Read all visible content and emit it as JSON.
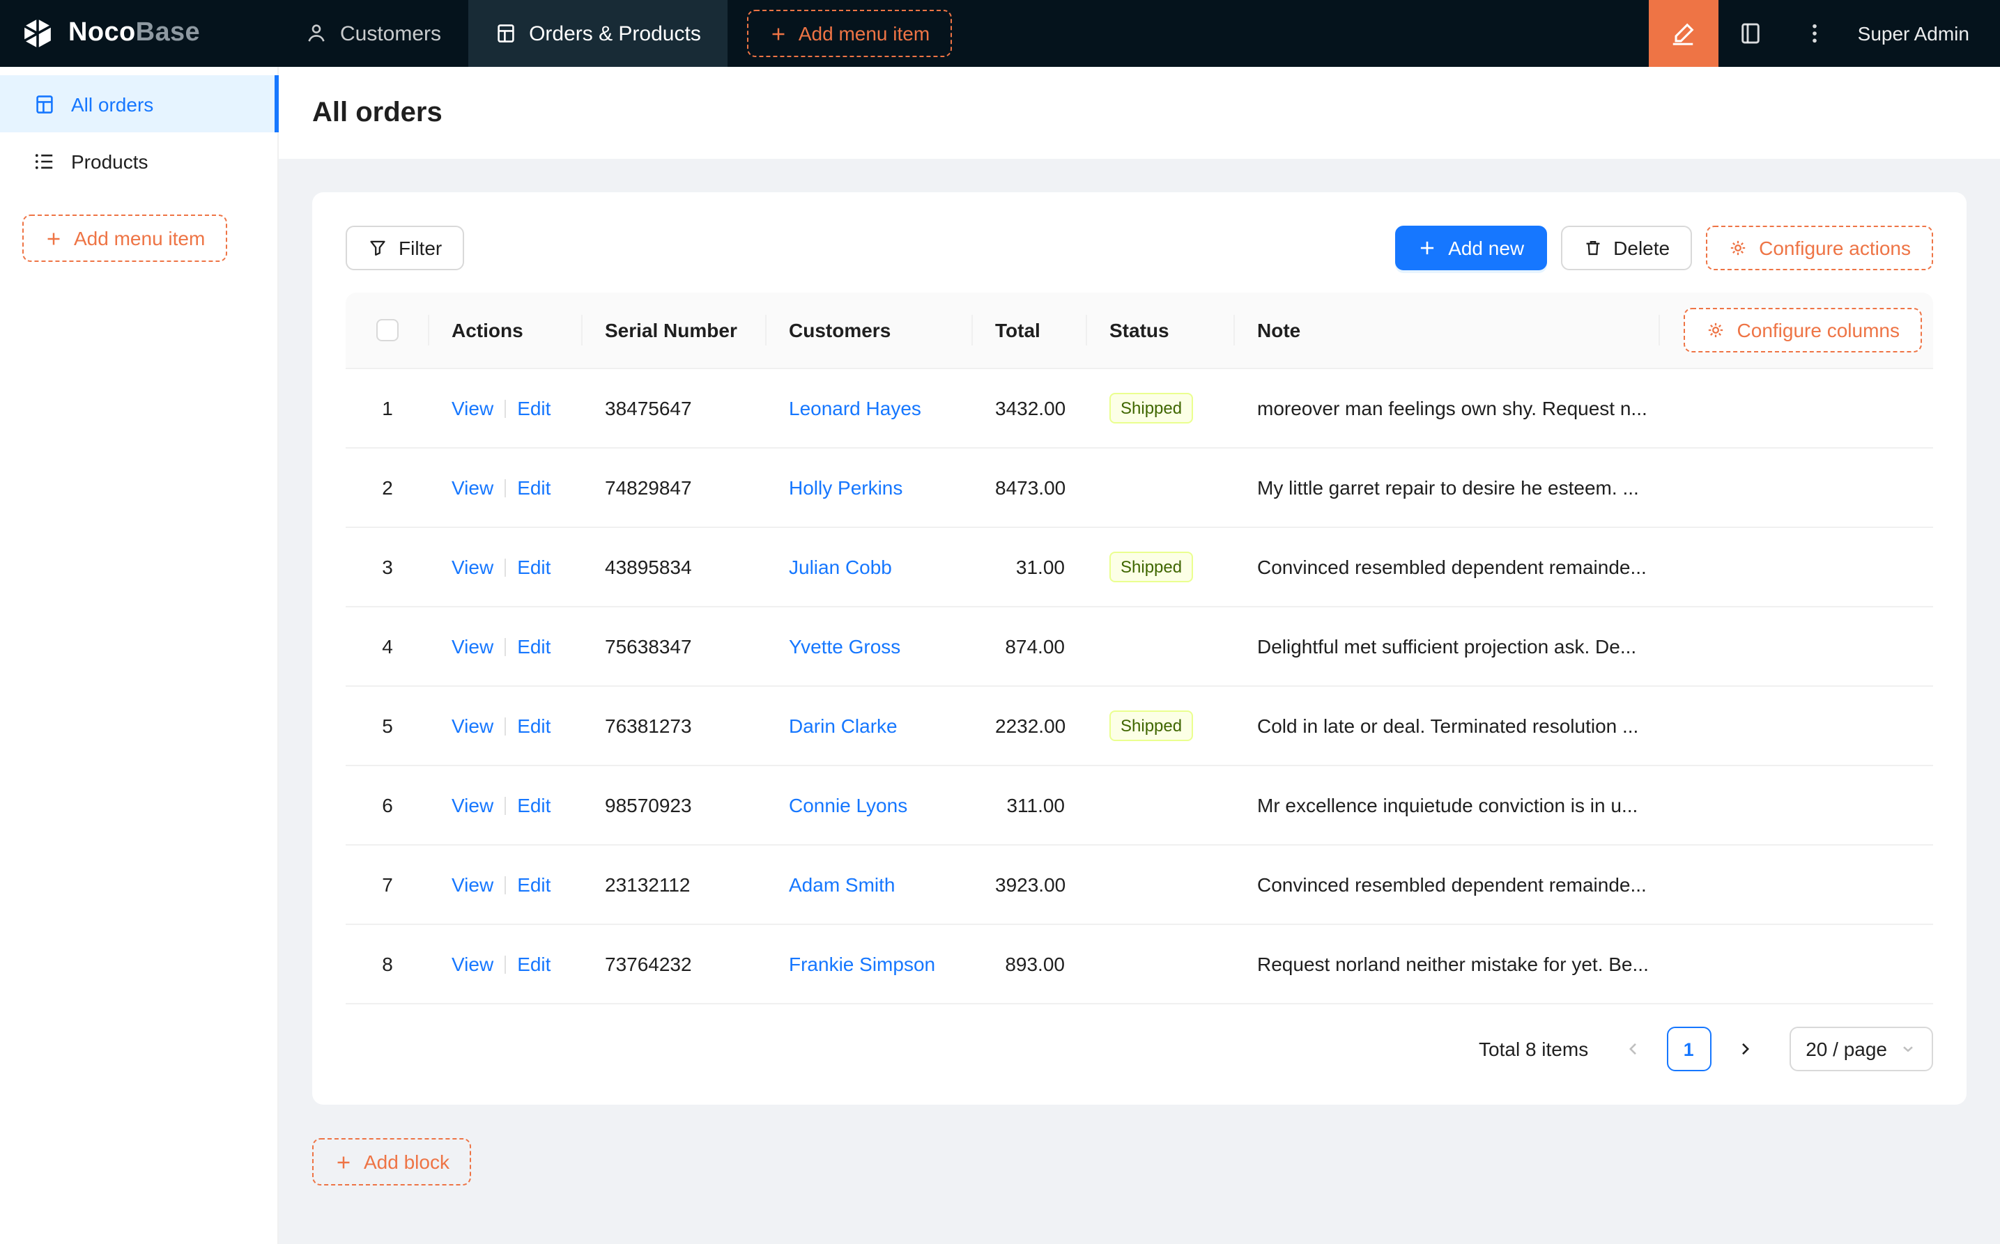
{
  "colors": {
    "accent_orange": "#ee7445",
    "primary_blue": "#1677ff",
    "header_bg": "#05131c",
    "header_active_bg": "#182b36",
    "sidebar_active_bg": "#e6f4ff",
    "tag_bg": "#fcffe6",
    "tag_border": "#eaff8f",
    "tag_text": "#3f6600"
  },
  "header": {
    "logo_noco": "Noco",
    "logo_base": "Base",
    "menu": [
      {
        "label": "Customers",
        "icon": "users-icon",
        "active": false
      },
      {
        "label": "Orders & Products",
        "icon": "table-file-icon",
        "active": true
      }
    ],
    "add_menu_item_label": "Add menu item",
    "right_icons": [
      "highlighter-icon",
      "collections-icon",
      "kebab-icon"
    ],
    "user_name": "Super Admin"
  },
  "sidebar": {
    "items": [
      {
        "label": "All orders",
        "icon": "table-file-icon",
        "active": true
      },
      {
        "label": "Products",
        "icon": "list-icon",
        "active": false
      }
    ],
    "add_menu_item_label": "Add menu item"
  },
  "page": {
    "title": "All orders"
  },
  "toolbar": {
    "filter_label": "Filter",
    "add_new_label": "Add new",
    "delete_label": "Delete",
    "configure_actions_label": "Configure actions"
  },
  "table": {
    "columns": [
      "Actions",
      "Serial Number",
      "Customers",
      "Total",
      "Status",
      "Note"
    ],
    "configure_columns_label": "Configure columns",
    "action_labels": {
      "view": "View",
      "edit": "Edit"
    },
    "rows": [
      {
        "index": "1",
        "serial_number": "38475647",
        "customer": "Leonard Hayes",
        "total": "3432.00",
        "status": "Shipped",
        "note": "moreover man feelings own shy. Request n..."
      },
      {
        "index": "2",
        "serial_number": "74829847",
        "customer": "Holly Perkins",
        "total": "8473.00",
        "status": "",
        "note": "My little garret repair to desire he esteem. ..."
      },
      {
        "index": "3",
        "serial_number": "43895834",
        "customer": "Julian Cobb",
        "total": "31.00",
        "status": "Shipped",
        "note": "Convinced resembled dependent remainde..."
      },
      {
        "index": "4",
        "serial_number": "75638347",
        "customer": "Yvette Gross",
        "total": "874.00",
        "status": "",
        "note": "Delightful met sufficient projection ask. De..."
      },
      {
        "index": "5",
        "serial_number": "76381273",
        "customer": "Darin Clarke",
        "total": "2232.00",
        "status": "Shipped",
        "note": "Cold in late or deal. Terminated resolution ..."
      },
      {
        "index": "6",
        "serial_number": "98570923",
        "customer": "Connie Lyons",
        "total": "311.00",
        "status": "",
        "note": "Mr excellence inquietude conviction is in u..."
      },
      {
        "index": "7",
        "serial_number": "23132112",
        "customer": "Adam Smith",
        "total": "3923.00",
        "status": "",
        "note": "Convinced resembled dependent remainde..."
      },
      {
        "index": "8",
        "serial_number": "73764232",
        "customer": "Frankie Simpson",
        "total": "893.00",
        "status": "",
        "note": "Request norland neither mistake for yet. Be..."
      }
    ]
  },
  "pagination": {
    "total_text": "Total 8 items",
    "current_page": "1",
    "page_size_label": "20 / page"
  },
  "footer": {
    "add_block_label": "Add block"
  }
}
